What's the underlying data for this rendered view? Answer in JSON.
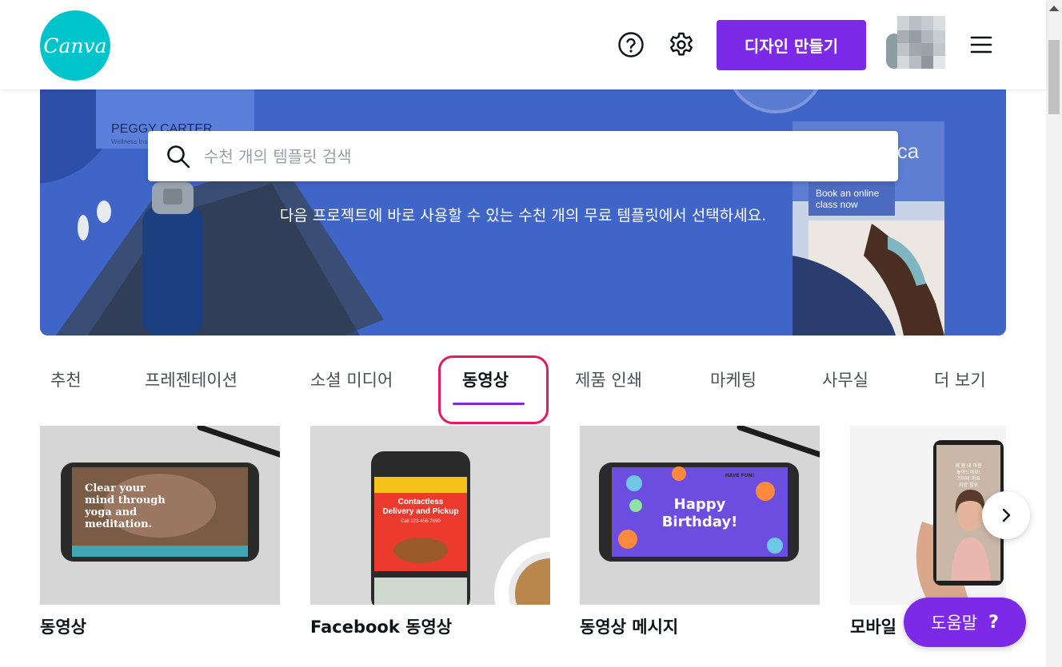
{
  "header": {
    "logo_text": "Canva",
    "create_button_label": "디자인 만들기"
  },
  "banner": {
    "search_placeholder": "수천 개의 템플릿 검색",
    "subtitle": "다음 프로젝트에 바로 사용할 수 있는 수천 개의 무료 템플릿에서 선택하세요.",
    "bg_card_left_name": "PEGGY CARTER",
    "bg_card_left_sub": "Wellness Inst...",
    "bg_card_right_brand": "istica",
    "bg_card_right_line1": "Book an online",
    "bg_card_right_line2": "class now"
  },
  "tabs": [
    {
      "label": "추천"
    },
    {
      "label": "프레젠테이션"
    },
    {
      "label": "소셜 미디어"
    },
    {
      "label": "동영상",
      "active": true
    },
    {
      "label": "제품 인쇄"
    },
    {
      "label": "마케팅"
    },
    {
      "label": "사무실"
    },
    {
      "label": "더 보기"
    }
  ],
  "cards": [
    {
      "label": "동영상",
      "thumb_lines": [
        "Clear your",
        "mind through",
        "yoga and",
        "meditation."
      ]
    },
    {
      "label": "Facebook 동영상",
      "thumb_lines": [
        "Contactless",
        "Delivery and Pickup",
        "Call 123-456-7890"
      ]
    },
    {
      "label": "동영상 메시지",
      "thumb_lines": [
        "Happy",
        "Birthday!",
        "HAVE FUN!"
      ]
    },
    {
      "label": "모바일",
      "thumb_lines": [
        "제 몸 내 마음",
        "놓아드려요!",
        "기미미 미요",
        "지방 필요"
      ]
    }
  ],
  "help_button": {
    "label": "도움말",
    "icon_text": "?"
  },
  "colors": {
    "brand_teal": "#00c4cc",
    "brand_purple": "#7d2ae8",
    "highlight_pink": "#e5195e",
    "banner_blue": "#3f65c8"
  },
  "icons": [
    "help-icon",
    "gear-icon",
    "menu-icon",
    "search-icon",
    "chevron-right-icon"
  ]
}
